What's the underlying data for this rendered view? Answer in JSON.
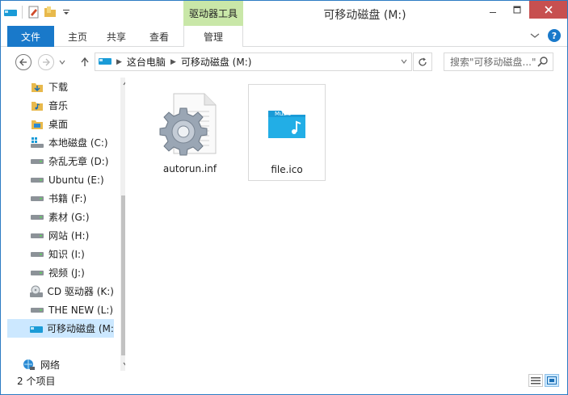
{
  "window": {
    "title": "可移动磁盘 (M:)",
    "context_tab_header": "驱动器工具"
  },
  "ribbon": {
    "tabs": [
      {
        "label": "文件",
        "active": true
      },
      {
        "label": "主页"
      },
      {
        "label": "共享"
      },
      {
        "label": "查看"
      },
      {
        "label": "管理"
      }
    ]
  },
  "address": {
    "crumbs": [
      "这台电脑",
      "可移动磁盘 (M:)"
    ],
    "search_placeholder": "搜索\"可移动磁盘...\""
  },
  "nav_pane": {
    "items": [
      {
        "label": "下载",
        "icon": "download-folder-icon"
      },
      {
        "label": "音乐",
        "icon": "music-folder-icon"
      },
      {
        "label": "桌面",
        "icon": "desktop-folder-icon"
      },
      {
        "label": "本地磁盘 (C:)",
        "icon": "windows-drive-icon"
      },
      {
        "label": "杂乱无章 (D:)",
        "icon": "drive-icon"
      },
      {
        "label": "Ubuntu (E:)",
        "icon": "drive-icon"
      },
      {
        "label": "书籍 (F:)",
        "icon": "drive-icon"
      },
      {
        "label": "素材 (G:)",
        "icon": "drive-icon"
      },
      {
        "label": "网站 (H:)",
        "icon": "drive-icon"
      },
      {
        "label": "知识 (I:)",
        "icon": "drive-icon"
      },
      {
        "label": "视频 (J:)",
        "icon": "drive-icon"
      },
      {
        "label": "CD 驱动器 (K:)",
        "icon": "cd-drive-icon"
      },
      {
        "label": "THE NEW (L:)",
        "icon": "drive-icon"
      },
      {
        "label": "可移动磁盘 (M:)",
        "icon": "removable-drive-icon",
        "selected": true
      }
    ],
    "network": {
      "label": "网络",
      "icon": "network-icon"
    }
  },
  "files": [
    {
      "name": "autorun.inf",
      "icon": "gear-settings-file-icon"
    },
    {
      "name": "file.ico",
      "icon": "music-folder-ico-icon",
      "selected": true
    }
  ],
  "status": {
    "item_count": "2 个项目"
  },
  "colors": {
    "accent": "#1979ca",
    "context_tab": "#c9e7a8",
    "selection": "#cce8ff",
    "close": "#c75050"
  }
}
